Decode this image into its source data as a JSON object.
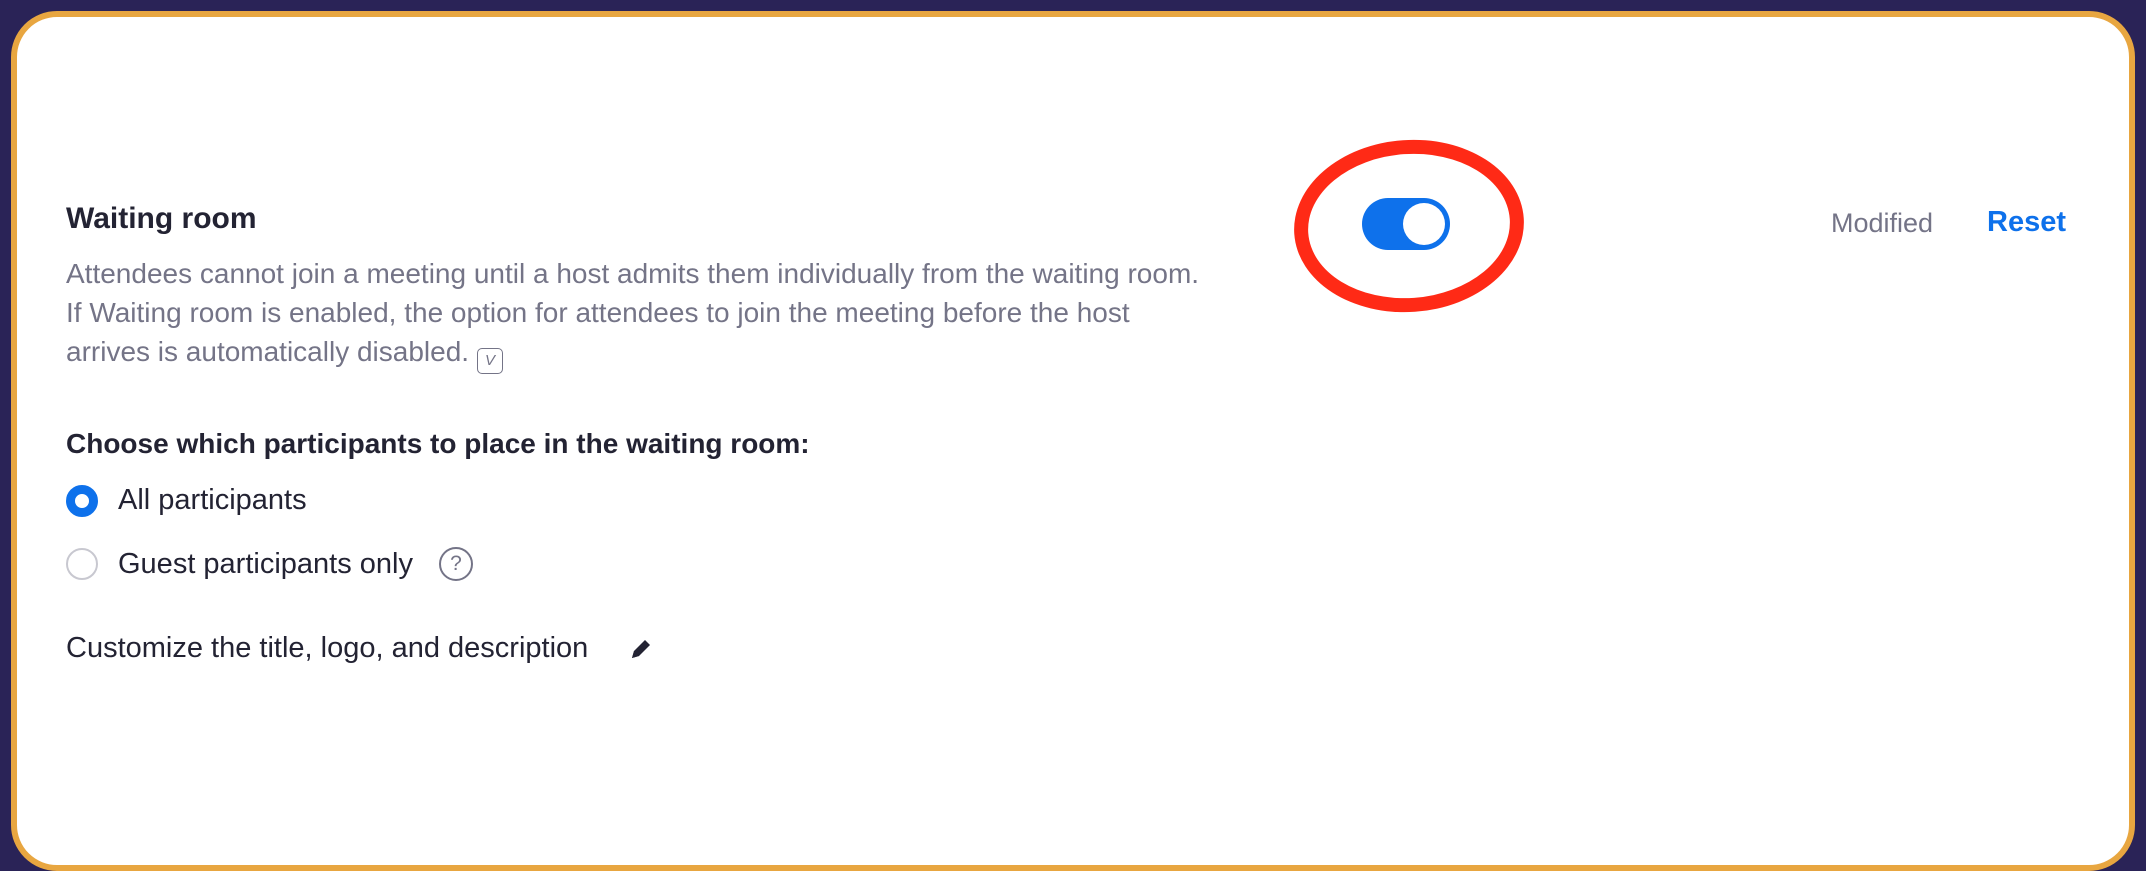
{
  "setting": {
    "title": "Waiting room",
    "description_lines": [
      "Attendees cannot join a meeting until a host admits them individually from the waiting room.",
      "If Waiting room is enabled, the option for attendees to join the meeting before the host",
      "arrives is automatically disabled."
    ],
    "video_icon_glyph": "V",
    "enabled": true,
    "status_text": "Modified",
    "reset_label": "Reset"
  },
  "participants": {
    "heading": "Choose which participants to place in the waiting room:",
    "options": [
      {
        "label": "All participants",
        "selected": true
      },
      {
        "label": "Guest participants only",
        "selected": false
      }
    ],
    "help_glyph": "?"
  },
  "customize": {
    "label": "Customize the title, logo, and description",
    "icon": "pencil-icon"
  },
  "colors": {
    "accent": "#0e71eb",
    "highlight_ring": "#ff2a16",
    "frame": "#e8a640",
    "background": "#2a2357"
  }
}
